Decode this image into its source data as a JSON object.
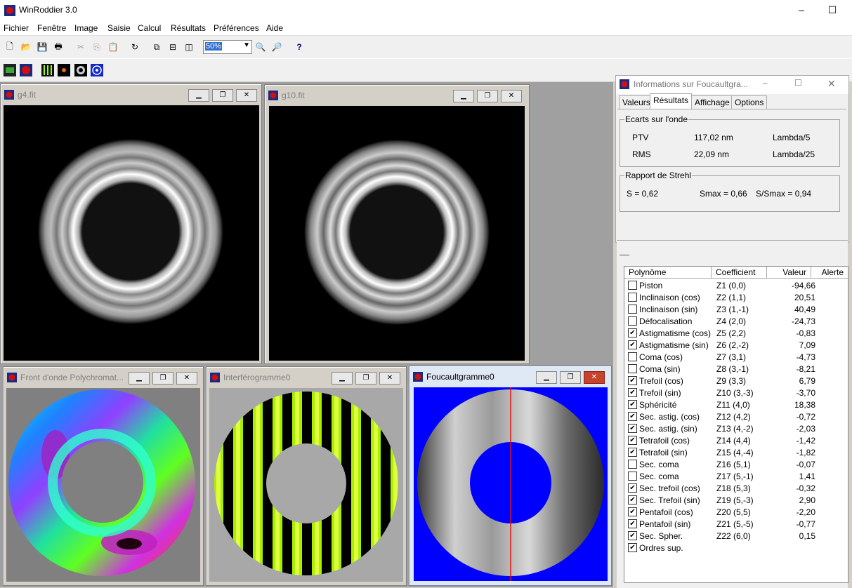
{
  "app": {
    "title": "WinRoddier 3.0"
  },
  "menu": [
    "Fichier",
    "Fenêtre",
    "Image",
    "Saisie",
    "Calcul",
    "Résultats",
    "Préférences",
    "Aide"
  ],
  "toolbar": {
    "zoom": "50%"
  },
  "windows": {
    "g4": {
      "title": "g4.fit"
    },
    "g10": {
      "title": "g10.fit"
    },
    "wavefront": {
      "title": "Front d'onde Polychromat..."
    },
    "interferogram": {
      "title": "Interférogramme0"
    },
    "foucault": {
      "title": "Foucaultgramme0"
    }
  },
  "info": {
    "title": "Informations sur Foucaultgra...",
    "tabs": [
      "Valeurs",
      "Résultats",
      "Affichage",
      "Options"
    ],
    "ecarts": {
      "title": "Ecarts sur l'onde",
      "ptv_label": "PTV",
      "ptv_value": "117,02 nm",
      "ptv_lambda": "Lambda/5",
      "rms_label": "RMS",
      "rms_value": "22,09 nm",
      "rms_lambda": "Lambda/25"
    },
    "strehl": {
      "title": "Rapport de Strehl",
      "s": "S = 0,62",
      "smax": "Smax = 0,66",
      "ratio": "S/Smax = 0,94"
    }
  },
  "table": {
    "headers": [
      "Polynôme",
      "Coefficient",
      "Valeur",
      "Alerte"
    ],
    "rows": [
      {
        "name": "Piston",
        "coef": "Z1 (0,0)",
        "value": "-94,66",
        "checked": false
      },
      {
        "name": "Inclinaison (cos)",
        "coef": "Z2 (1,1)",
        "value": "20,51",
        "checked": false
      },
      {
        "name": "Inclinaison (sin)",
        "coef": "Z3 (1,-1)",
        "value": "40,49",
        "checked": false
      },
      {
        "name": "Défocalisation",
        "coef": "Z4 (2,0)",
        "value": "-24,73",
        "checked": false
      },
      {
        "name": "Astigmatisme (cos)",
        "coef": "Z5 (2,2)",
        "value": "-0,83",
        "checked": true
      },
      {
        "name": "Astigmatisme (sin)",
        "coef": "Z6 (2,-2)",
        "value": "7,09",
        "checked": true
      },
      {
        "name": "Coma (cos)",
        "coef": "Z7 (3,1)",
        "value": "-4,73",
        "checked": false
      },
      {
        "name": "Coma (sin)",
        "coef": "Z8 (3,-1)",
        "value": "-8,21",
        "checked": false
      },
      {
        "name": "Trefoil (cos)",
        "coef": "Z9 (3,3)",
        "value": "6,79",
        "checked": true
      },
      {
        "name": "Trefoil (sin)",
        "coef": "Z10 (3,-3)",
        "value": "-3,70",
        "checked": true
      },
      {
        "name": "Sphéricité",
        "coef": "Z11 (4,0)",
        "value": "18,38",
        "checked": true
      },
      {
        "name": "Sec. astig. (cos)",
        "coef": "Z12 (4,2)",
        "value": "-0,72",
        "checked": true
      },
      {
        "name": "Sec. astig. (sin)",
        "coef": "Z13 (4,-2)",
        "value": "-2,03",
        "checked": true
      },
      {
        "name": "Tetrafoil (cos)",
        "coef": "Z14 (4,4)",
        "value": "-1,42",
        "checked": true
      },
      {
        "name": "Tetrafoil (sin)",
        "coef": "Z15 (4,-4)",
        "value": "-1,82",
        "checked": true
      },
      {
        "name": "Sec. coma",
        "coef": "Z16 (5,1)",
        "value": "-0,07",
        "checked": false
      },
      {
        "name": "Sec. coma",
        "coef": "Z17 (5,-1)",
        "value": "1,41",
        "checked": false
      },
      {
        "name": "Sec. trefoil (cos)",
        "coef": "Z18 (5,3)",
        "value": "-0,32",
        "checked": true
      },
      {
        "name": "Sec. Trefoil (sin)",
        "coef": "Z19 (5,-3)",
        "value": "2,90",
        "checked": true
      },
      {
        "name": "Pentafoil (cos)",
        "coef": "Z20 (5,5)",
        "value": "-2,20",
        "checked": true
      },
      {
        "name": "Pentafoil (sin)",
        "coef": "Z21 (5,-5)",
        "value": "-0,77",
        "checked": true
      },
      {
        "name": "Sec. Spher.",
        "coef": "Z22 (6,0)",
        "value": "0,15",
        "checked": true
      },
      {
        "name": "Ordres sup.",
        "coef": "",
        "value": "",
        "checked": true
      }
    ]
  }
}
